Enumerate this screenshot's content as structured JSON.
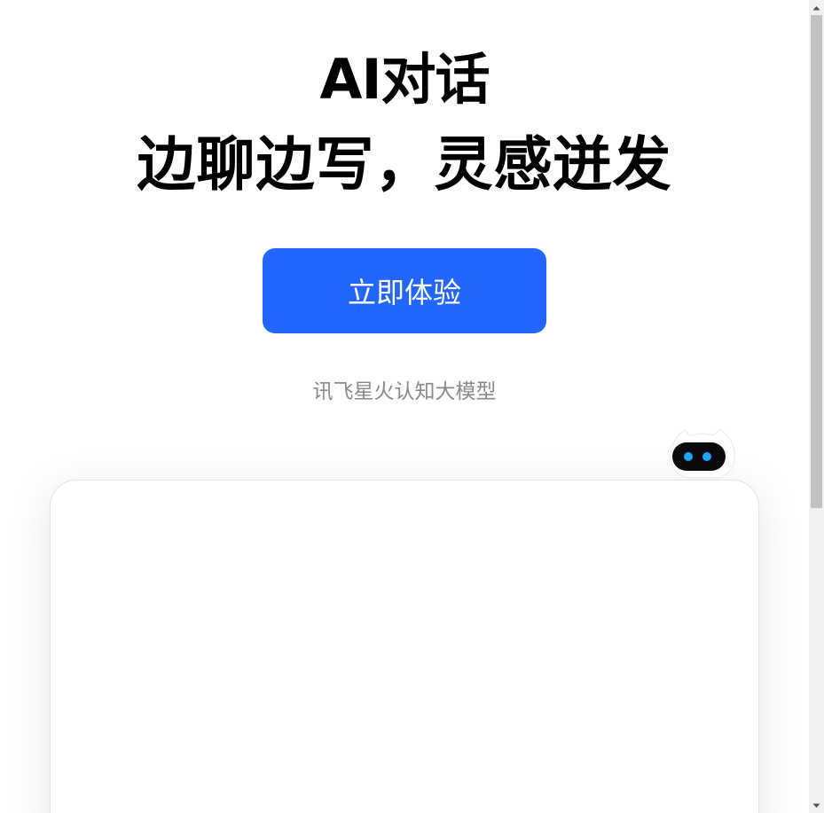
{
  "hero": {
    "title_line_1": "AI对话",
    "title_line_2": "边聊边写，灵感迸发",
    "cta_label": "立即体验",
    "subtitle": "讯飞星火认知大模型"
  },
  "mascot": {
    "icon": "robot-mascot-icon",
    "eye_color": "#1fa3ff",
    "face_color": "#0a0a0a"
  },
  "colors": {
    "accent": "#2266ff",
    "subtitle": "#8a8a8a"
  },
  "scrollbar": {
    "thumb_fraction": 0.63
  }
}
